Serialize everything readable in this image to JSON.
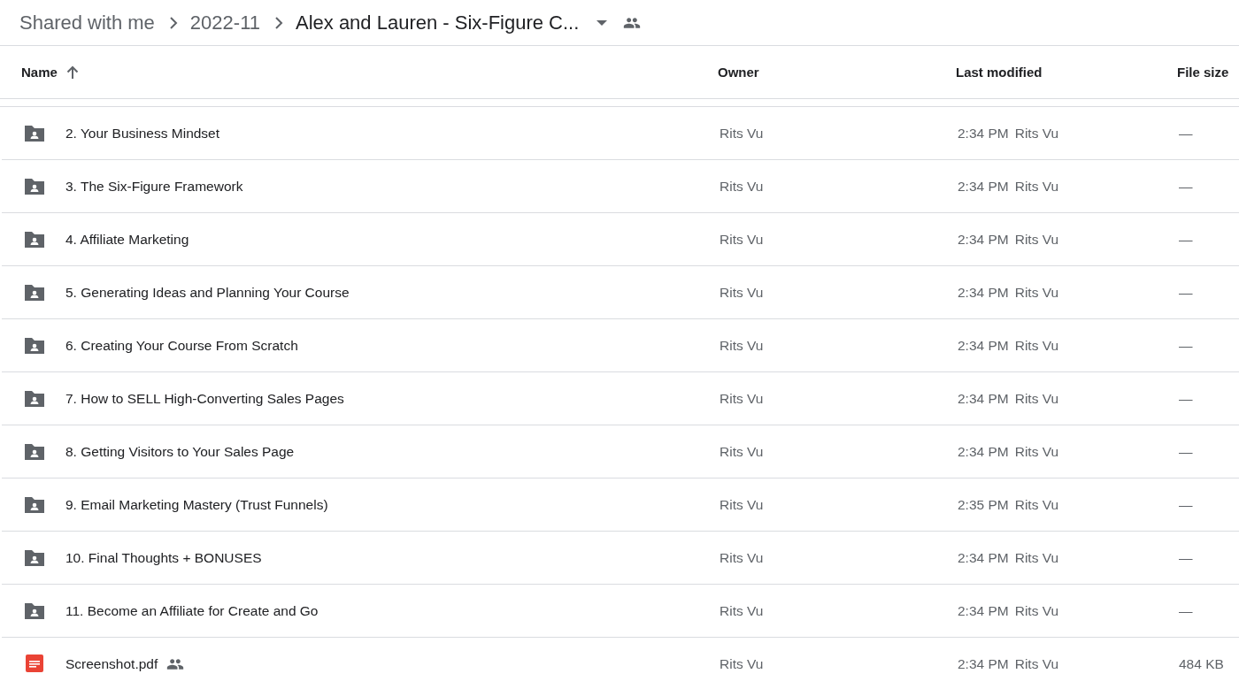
{
  "breadcrumb": [
    {
      "label": "Shared with me",
      "current": false
    },
    {
      "label": "2022-11",
      "current": false
    },
    {
      "label": "Alex and Lauren - Six-Figure C...",
      "current": true
    }
  ],
  "columns": [
    "Name",
    "Owner",
    "Last modified",
    "File size"
  ],
  "files": [
    {
      "kind": "folder",
      "name": "2. Your Business Mindset",
      "shared": false,
      "owner": "Rits Vu",
      "modified": "2:34 PM",
      "modified_by": "Rits Vu",
      "size": "—"
    },
    {
      "kind": "folder",
      "name": "3. The Six-Figure Framework",
      "shared": false,
      "owner": "Rits Vu",
      "modified": "2:34 PM",
      "modified_by": "Rits Vu",
      "size": "—"
    },
    {
      "kind": "folder",
      "name": "4. Affiliate Marketing",
      "shared": false,
      "owner": "Rits Vu",
      "modified": "2:34 PM",
      "modified_by": "Rits Vu",
      "size": "—"
    },
    {
      "kind": "folder",
      "name": "5. Generating Ideas and Planning Your Course",
      "shared": false,
      "owner": "Rits Vu",
      "modified": "2:34 PM",
      "modified_by": "Rits Vu",
      "size": "—"
    },
    {
      "kind": "folder",
      "name": "6. Creating Your Course From Scratch",
      "shared": false,
      "owner": "Rits Vu",
      "modified": "2:34 PM",
      "modified_by": "Rits Vu",
      "size": "—"
    },
    {
      "kind": "folder",
      "name": "7. How to SELL High-Converting Sales Pages",
      "shared": false,
      "owner": "Rits Vu",
      "modified": "2:34 PM",
      "modified_by": "Rits Vu",
      "size": "—"
    },
    {
      "kind": "folder",
      "name": "8. Getting Visitors to Your Sales Page",
      "shared": false,
      "owner": "Rits Vu",
      "modified": "2:34 PM",
      "modified_by": "Rits Vu",
      "size": "—"
    },
    {
      "kind": "folder",
      "name": "9. Email Marketing Mastery (Trust Funnels)",
      "shared": false,
      "owner": "Rits Vu",
      "modified": "2:35 PM",
      "modified_by": "Rits Vu",
      "size": "—"
    },
    {
      "kind": "folder",
      "name": "10. Final Thoughts + BONUSES",
      "shared": false,
      "owner": "Rits Vu",
      "modified": "2:34 PM",
      "modified_by": "Rits Vu",
      "size": "—"
    },
    {
      "kind": "folder",
      "name": "11. Become an Affiliate for Create and Go",
      "shared": false,
      "owner": "Rits Vu",
      "modified": "2:34 PM",
      "modified_by": "Rits Vu",
      "size": "—"
    },
    {
      "kind": "pdf",
      "name": "Screenshot.pdf",
      "shared": true,
      "owner": "Rits Vu",
      "modified": "2:34 PM",
      "modified_by": "Rits Vu",
      "size": "484 KB"
    }
  ]
}
